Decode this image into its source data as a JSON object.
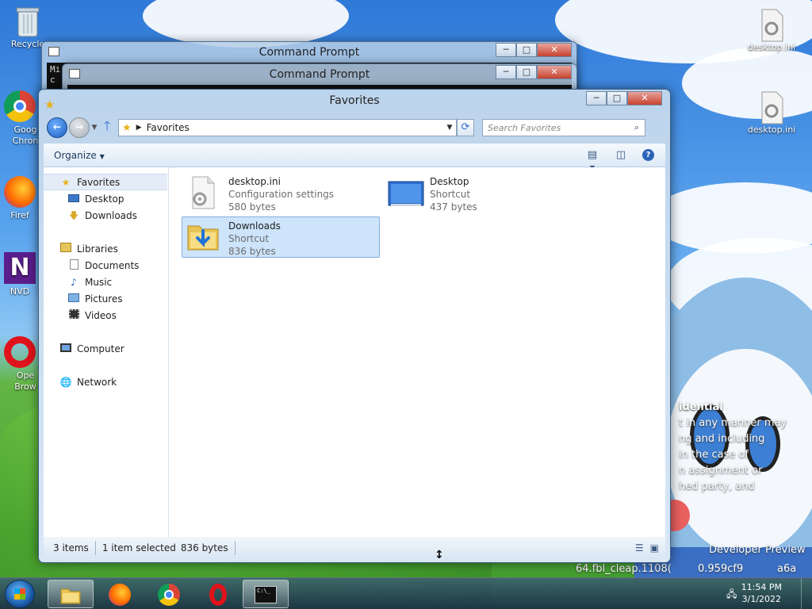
{
  "desktop": {
    "icons_left": [
      "Recycle",
      "Goog Chron",
      "Firef",
      "NVD",
      "Ope Brow"
    ],
    "icons_right": [
      "desktop.ini",
      "desktop.ini"
    ],
    "overlay_text": [
      "idential",
      "t in any manner may",
      "ng and including",
      "in the case of",
      "n assignment or",
      "hed party, and",
      "Developer Preview",
      "64.fbl_cleap.1108(",
      "0.959cf9",
      "a6a"
    ]
  },
  "cmd_window_1": {
    "title": "Command Prompt",
    "fragment": "Mi\nc"
  },
  "cmd_window_2": {
    "title": "Command Prompt"
  },
  "explorer": {
    "title": "Favorites",
    "address": "Favorites",
    "search_placeholder": "Search Favorites",
    "toolbar": {
      "organize_label": "Organize",
      "organize_arrow": "▼"
    },
    "nav": [
      {
        "label": "Favorites",
        "icon": "star-icon",
        "sub": false,
        "selected": true
      },
      {
        "label": "Desktop",
        "icon": "desktop-icon",
        "sub": true
      },
      {
        "label": "Downloads",
        "icon": "downloads-folder-icon",
        "sub": true
      },
      {
        "gap": true
      },
      {
        "label": "Libraries",
        "icon": "libraries-icon",
        "sub": false
      },
      {
        "label": "Documents",
        "icon": "documents-icon",
        "sub": true
      },
      {
        "label": "Music",
        "icon": "music-icon",
        "sub": true
      },
      {
        "label": "Pictures",
        "icon": "pictures-icon",
        "sub": true
      },
      {
        "label": "Videos",
        "icon": "videos-icon",
        "sub": true
      },
      {
        "gap": true
      },
      {
        "label": "Computer",
        "icon": "computer-icon",
        "sub": false
      },
      {
        "gap": true
      },
      {
        "label": "Network",
        "icon": "network-icon",
        "sub": false
      }
    ],
    "files": [
      {
        "name": "desktop.ini",
        "type": "Configuration settings",
        "size": "580 bytes",
        "icon": "settings-file-icon",
        "selected": false
      },
      {
        "name": "Desktop",
        "type": "Shortcut",
        "size": "437 bytes",
        "icon": "desktop-shortcut-icon",
        "selected": false
      },
      {
        "name": "Downloads",
        "type": "Shortcut",
        "size": "836 bytes",
        "icon": "downloads-shortcut-icon",
        "selected": true
      }
    ],
    "status": {
      "items": "3 items",
      "selected": "1 item selected",
      "size": "836 bytes"
    }
  },
  "taskbar": {
    "buttons": [
      {
        "name": "explorer",
        "icon": "folder-icon",
        "active": true
      },
      {
        "name": "firefox",
        "icon": "firefox-icon",
        "active": false
      },
      {
        "name": "chrome",
        "icon": "chrome-icon",
        "active": false
      },
      {
        "name": "opera",
        "icon": "opera-icon",
        "active": false
      },
      {
        "name": "cmd",
        "icon": "cmd-icon",
        "active": true
      }
    ],
    "cmd_icon_text": "C:\\_",
    "time": "11:54 PM",
    "date": "3/1/2022"
  }
}
